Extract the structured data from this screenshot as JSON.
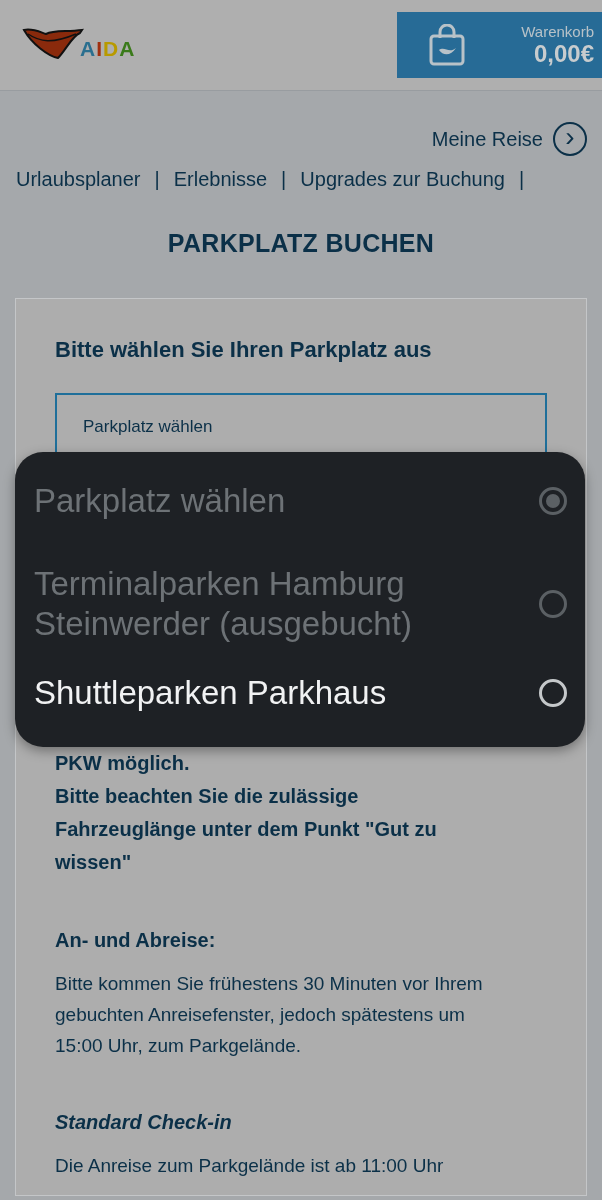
{
  "header": {
    "logo_text": "AIDA",
    "cart": {
      "label": "Warenkorb",
      "amount": "0,00€"
    }
  },
  "my_trip": {
    "label": "Meine Reise",
    "icon": "›"
  },
  "nav": {
    "items": [
      "Urlaubsplaner",
      "Erlebnisse",
      "Upgrades zur Buchung"
    ],
    "separator": "|"
  },
  "page_title": "PARKPLATZ BUCHEN",
  "card": {
    "heading": "Bitte wählen Sie Ihren Parkplatz aus",
    "select": {
      "value": "Parkplatz wählen"
    },
    "notice": [
      "PKW möglich.",
      "Bitte beachten Sie die zulässige Fahrzeuglänge unter dem Punkt \"Gut zu wissen\""
    ],
    "sections": [
      {
        "kind": "plain",
        "title": "An- und Abreise:",
        "text": "Bitte kommen Sie frühestens 30 Minuten vor Ihrem gebuchten Anreisefenster, jedoch spätestens um 15:00 Uhr, zum Parkgelände."
      },
      {
        "kind": "italic",
        "title": "Standard Check-in",
        "text": "Die Anreise zum Parkgelände ist ab 11:00 Uhr"
      }
    ]
  },
  "dropdown": {
    "options": [
      {
        "label": "Parkplatz wählen",
        "selected": true,
        "disabled": true
      },
      {
        "label": "Terminalparken Hamburg Steinwerder (ausgebucht)",
        "selected": false,
        "disabled": true
      },
      {
        "label": "Shuttleparken Parkhaus",
        "selected": false,
        "disabled": false
      }
    ]
  }
}
